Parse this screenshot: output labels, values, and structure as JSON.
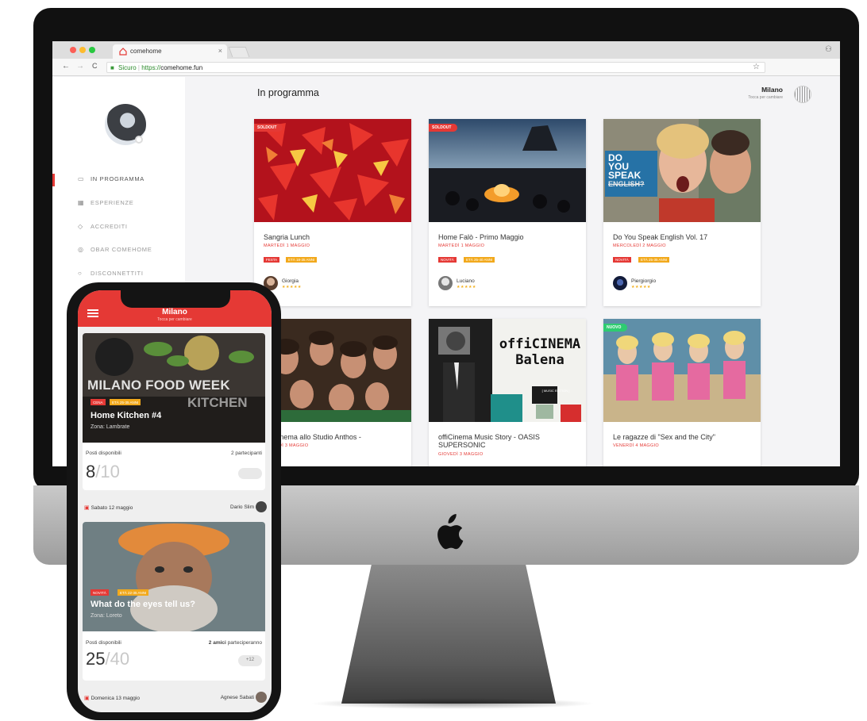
{
  "browser": {
    "tab_title": "comehome",
    "tab_close": "×",
    "url_secure": "Sicuro",
    "url_proto": "https://",
    "url_host": "comehome.fun",
    "back": "←",
    "forward": "→",
    "reload": "C",
    "bookmark": "☆"
  },
  "sidebar": {
    "items": [
      {
        "icon": "calendar-icon",
        "label": "IN PROGRAMMA"
      },
      {
        "icon": "grid-icon",
        "label": "ESPERIENZE"
      },
      {
        "icon": "tag-icon",
        "label": "ACCREDITI"
      },
      {
        "icon": "info-icon",
        "label": "OBAR COMEHOME"
      },
      {
        "icon": "logout-icon",
        "label": "DISCONNETTITI"
      }
    ]
  },
  "main": {
    "title": "In programma",
    "city": "Milano",
    "city_sub": "Tocca per cambiare"
  },
  "cards": [
    {
      "title": "Sangria Lunch",
      "date": "MARTEDÌ 1 MAGGIO",
      "badge": "SOLDOUT",
      "tags": [
        "FESTA",
        "ETÀ 18-35 ANNI"
      ],
      "host": "Giorgia",
      "stars": "★★★★★"
    },
    {
      "title": "Home Falò - Primo Maggio",
      "date": "MARTEDÌ 1 MAGGIO",
      "badge": "SOLDOUT",
      "tags": [
        "NOVITÀ",
        "ETÀ 25-40 ANNI"
      ],
      "host": "Luciano",
      "stars": "★★★★★"
    },
    {
      "title": "Do You Speak English Vol. 17",
      "date": "MERCOLEDÌ 2 MAGGIO",
      "badge": "",
      "tags": [
        "NOVITÀ",
        "ETÀ 25-35 ANNI"
      ],
      "host": "Piergiorgio",
      "stars": "★★★★★"
    },
    {
      "title": "offiCinema allo Studio Anthos -",
      "date": "GIOVEDÌ 3 MAGGIO",
      "badge": "",
      "tags": [],
      "host": "",
      "stars": ""
    },
    {
      "title": "offiCinema Music Story - OASIS SUPERSONIC",
      "date": "GIOVEDÌ 3 MAGGIO",
      "badge": "",
      "tags": [],
      "host": "",
      "stars": ""
    },
    {
      "title": "Le ragazze di \"Sex and the City\"",
      "date": "VENERDÌ 4 MAGGIO",
      "badge": "NUOVO",
      "tags": [],
      "host": "",
      "stars": ""
    }
  ],
  "poster": {
    "speak_lines": [
      "DO",
      "YOU",
      "SPEAK",
      "ENGLISH?"
    ],
    "officinema_line1": "offiCINEMA",
    "officinema_line2": "Balena",
    "officinema_tag": "[ MUSIC EDITION ]"
  },
  "phone": {
    "city": "Milano",
    "city_sub": "Tocca per cambiare",
    "card1": {
      "overlay_line1": "MILANO FOOD WEEK",
      "overlay_line2": "KITCHEN",
      "tags": [
        "CENA",
        "ETÀ 25-35 ANNI"
      ],
      "title": "Home Kitchen #4",
      "zone": "Zona: Lambrate",
      "posti_label": "Posti disponibili",
      "partecipanti": "2 partecipanti",
      "posti": "8",
      "posti_total": "/10"
    },
    "row2": {
      "date": "Sabato 12 maggio",
      "host": "Dario Slim"
    },
    "card2": {
      "tags": [
        "NOVITÀ",
        "ETÀ 22-35 ANNI"
      ],
      "title": "What do the eyes tell us?",
      "zone": "Zona: Loreto",
      "posti_label": "Posti disponibili",
      "amici_bold": "2 amici",
      "amici_rest": " parteciperanno",
      "mini": "+12",
      "posti": "25",
      "posti_total": "/40"
    },
    "row3": {
      "date": "Domenica 13 maggio",
      "host": "Agnese Sabati"
    }
  },
  "colors": {
    "accent": "#e53935",
    "tag_orange": "#f2a91c",
    "badge_green": "#2ecc71"
  }
}
